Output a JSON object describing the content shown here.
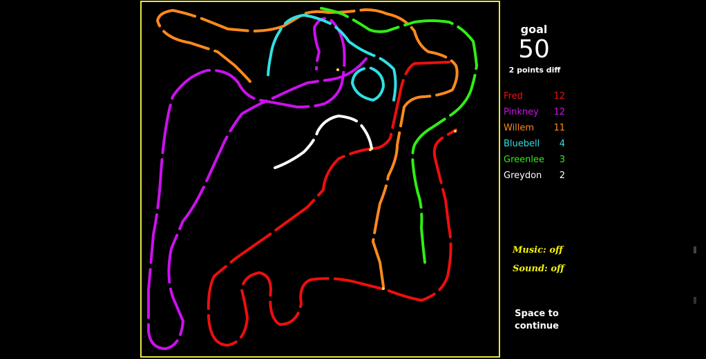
{
  "goal": {
    "label": "goal",
    "value": "50",
    "diff": "2 points diff"
  },
  "players": [
    {
      "name": "Fred",
      "score": "12",
      "color": "#ee0e0e"
    },
    {
      "name": "Pinkney",
      "score": "12",
      "color": "#cc10ee"
    },
    {
      "name": "Willem",
      "score": "11",
      "color": "#ff8a1c"
    },
    {
      "name": "Bluebell",
      "score": "4",
      "color": "#30e0e6"
    },
    {
      "name": "Greenlee",
      "score": "3",
      "color": "#30ee14"
    },
    {
      "name": "Greydon",
      "score": "2",
      "color": "#ffffff"
    }
  ],
  "settings": {
    "music": {
      "label": "Music:",
      "value": "off"
    },
    "sound": {
      "label": "Sound:",
      "value": "off"
    }
  },
  "prompt": {
    "line1": "Space to",
    "line2": "continue"
  },
  "colors": {
    "border": "#e8e84a",
    "settings_text": "#f2f20a",
    "background": "#000000"
  }
}
